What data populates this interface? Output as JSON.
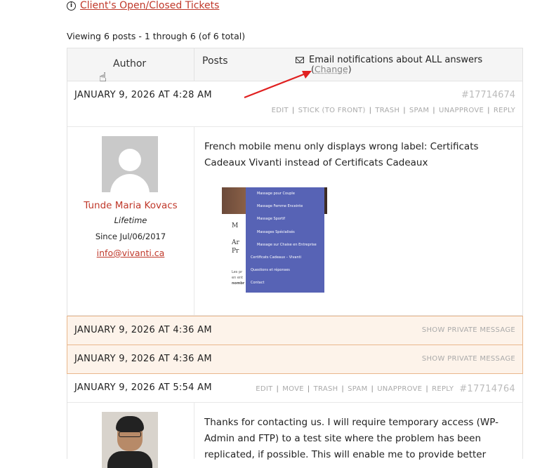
{
  "top_link": {
    "label": "Client's Open/Closed Tickets",
    "icon": "info-icon"
  },
  "viewing_text": "Viewing 6 posts - 1 through 6 (of 6 total)",
  "table_header": {
    "author": "Author",
    "posts": "Posts",
    "subscription_text": "Email notifications about ALL answers",
    "change_open": "(",
    "change_label": "Change",
    "change_close": ")"
  },
  "posts": [
    {
      "date": "JANUARY 9, 2026 AT 4:28 AM",
      "id": "#17714674",
      "actions": [
        "EDIT",
        "STICK (TO FRONT)",
        "TRASH",
        "SPAM",
        "UNAPPROVE",
        "REPLY"
      ],
      "author": {
        "name": "Tunde Maria Kovacs",
        "role": "Lifetime",
        "since": "Since Jul/06/2017",
        "email": "info@vivanti.ca"
      },
      "content": "French mobile menu only displays wrong label: Certificats Cadeaux Vivanti instead of Certificats Cadeaux",
      "screenshot_menu": [
        "Massage pour Couple",
        "Massage Femme Enceinte",
        "Massage Sportif",
        "Massages Spécialisés",
        "Massage sur Chaise en Entreprise",
        "Certificats Cadeaux – Vivanti",
        "Questions et réponses",
        "Contact"
      ]
    }
  ],
  "private_rows": [
    {
      "date": "JANUARY 9, 2026 AT 4:36 AM",
      "action": "SHOW PRIVATE MESSAGE"
    },
    {
      "date": "JANUARY 9, 2026 AT 4:36 AM",
      "action": "SHOW PRIVATE MESSAGE"
    }
  ],
  "reply": {
    "date": "JANUARY 9, 2026 AT 5:54 AM",
    "actions": [
      "EDIT",
      "MOVE",
      "TRASH",
      "SPAM",
      "UNAPPROVE",
      "REPLY"
    ],
    "id": "#17714764",
    "content": "Thanks for contacting us. I will require temporary access (WP-Admin and FTP) to a test site where the problem has been replicated, if possible. This will enable me to provide better"
  },
  "colors": {
    "accent": "#c0392b",
    "private_bg": "#fdf3ea",
    "private_border": "#e9b78c",
    "arrow": "#e02020"
  }
}
